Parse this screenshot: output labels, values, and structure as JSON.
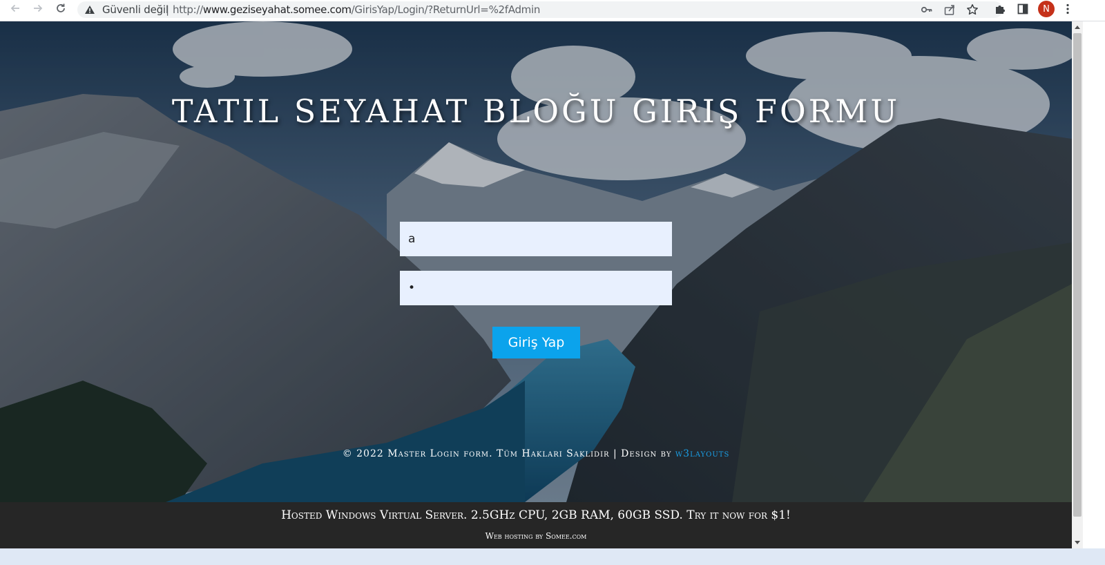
{
  "browser": {
    "security_label": "Güvenli değil",
    "separator": "|",
    "url_prefix": "http://",
    "url_host": "www.geziseyahat.somee.com",
    "url_path": "/GirisYap/Login/?ReturnUrl=%2fAdmin",
    "avatar_initial": "N",
    "icons": [
      "back-icon",
      "forward-icon",
      "reload-icon",
      "warning-icon",
      "key-icon",
      "share-icon",
      "star-icon",
      "extensions-icon",
      "side-panel-icon",
      "menu-icon"
    ]
  },
  "page": {
    "title": "TATIL SEYAHAT BLOĞU GIRIŞ FORMU",
    "form": {
      "username_value": "a",
      "password_value": "a",
      "submit_label": "Giriş Yap"
    },
    "footer": {
      "copyright_text": "© 2022 Master Login form. Tüm Hakları Saklıdır | Design by",
      "design_link": "w3layouts"
    }
  },
  "host_banner": {
    "line1": "Hosted Windows Virtual Server. 2.5GHz CPU, 2GB RAM, 60GB SSD. Try it now for $1!",
    "line2": "Web hosting by Somee.com"
  },
  "colors": {
    "accent": "#0ba3ec",
    "link": "#1aa0e8",
    "banner": "#262626",
    "input_bg": "#e8f0fe"
  }
}
